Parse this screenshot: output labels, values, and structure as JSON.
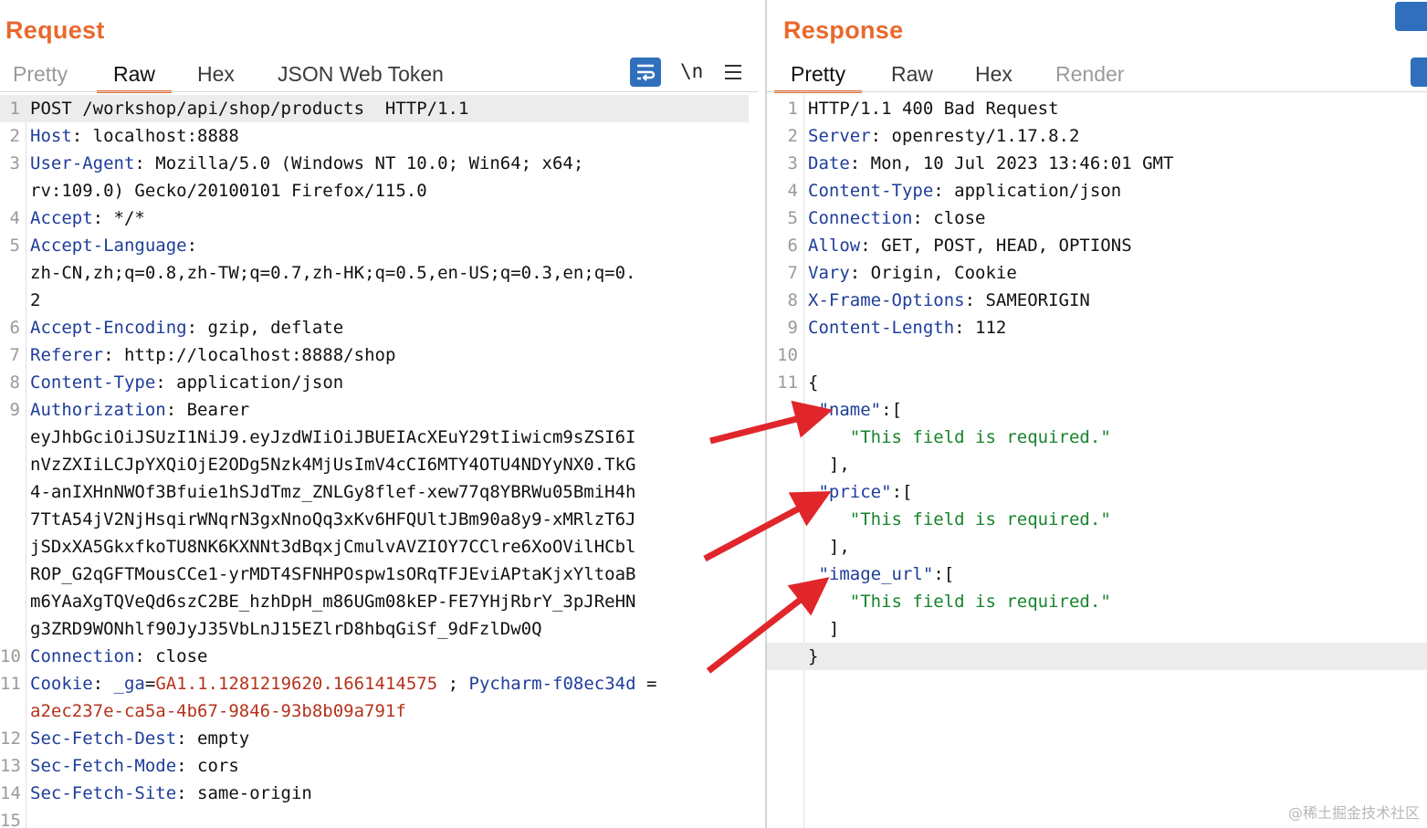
{
  "request": {
    "title": "Request",
    "tabs": [
      {
        "label": "Pretty",
        "active": false,
        "dim": true
      },
      {
        "label": "Raw",
        "active": true,
        "dim": false
      },
      {
        "label": "Hex",
        "active": false,
        "dim": false
      },
      {
        "label": "JSON Web Token",
        "active": false,
        "dim": false
      }
    ],
    "toolbar": {
      "wrap_icon": "wrap-text-icon",
      "newline_label": "\\n",
      "menu_icon": "hamburger-menu-icon"
    },
    "lines": [
      {
        "n": "1",
        "text": "POST /workshop/api/shop/products  HTTP/1.1"
      },
      {
        "n": "2",
        "key": "Host",
        "value": "localhost:8888"
      },
      {
        "n": "3",
        "key": "User-Agent",
        "value": "Mozilla/5.0 (Windows NT 10.0; Win64; x64;"
      },
      {
        "n": "",
        "text": "rv:109.0) Gecko/20100101 Firefox/115.0"
      },
      {
        "n": "4",
        "key": "Accept",
        "value": "*/*"
      },
      {
        "n": "5",
        "key": "Accept-Language",
        "value": ""
      },
      {
        "n": "",
        "text": "zh-CN,zh;q=0.8,zh-TW;q=0.7,zh-HK;q=0.5,en-US;q=0.3,en;q=0."
      },
      {
        "n": "",
        "text": "2"
      },
      {
        "n": "6",
        "key": "Accept-Encoding",
        "value": "gzip, deflate"
      },
      {
        "n": "7",
        "key": "Referer",
        "value": "http://localhost:8888/shop"
      },
      {
        "n": "8",
        "key": "Content-Type",
        "value": "application/json"
      },
      {
        "n": "9",
        "key": "Authorization",
        "value": "Bearer"
      },
      {
        "n": "",
        "text": "eyJhbGciOiJSUzI1NiJ9.eyJzdWIiOiJBUEIAcXEuY29tIiwicm9sZSI6I"
      },
      {
        "n": "",
        "text": "nVzZXIiLCJpYXQiOjE2ODg5Nzk4MjUsImV4cCI6MTY4OTU4NDYyNX0.TkG"
      },
      {
        "n": "",
        "text": "4-anIXHnNWOf3Bfuie1hSJdTmz_ZNLGy8flef-xew77q8YBRWu05BmiH4h"
      },
      {
        "n": "",
        "text": "7TtA54jV2NjHsqirWNqrN3gxNnoQq3xKv6HFQUltJBm90a8y9-xMRlzT6J"
      },
      {
        "n": "",
        "text": "jSDxXA5GkxfkoTU8NK6KXNNt3dBqxjCmulvAVZIOY7CClre6XoOVilHCbl"
      },
      {
        "n": "",
        "text": "ROP_G2qGFTMousCCe1-yrMDT4SFNHPOspw1sORqTFJEviAPtaKjxYltoaB"
      },
      {
        "n": "",
        "text": "m6YAaXgTQVeQd6szC2BE_hzhDpH_m86UGm08kEP-FE7YHjRbrY_3pJReHN"
      },
      {
        "n": "",
        "text": "g3ZRD9WONhlf90JyJ35VbLnJ15EZlrD8hbqGiSf_9dFzlDw0Q"
      },
      {
        "n": "10",
        "key": "Connection",
        "value": "close"
      },
      {
        "n": "11",
        "key": "Cookie",
        "cookie1_name": "_ga",
        "cookie1_value": "GA1.1.1281219620.1661414575",
        "cookie2_name": "Pycharm-f08ec34d",
        "cookie2_value": "a2ec237e-ca5a-4b67-9846-93b8b09a791f"
      },
      {
        "n": "12",
        "key": "Sec-Fetch-Dest",
        "value": "empty"
      },
      {
        "n": "13",
        "key": "Sec-Fetch-Mode",
        "value": "cors"
      },
      {
        "n": "14",
        "key": "Sec-Fetch-Site",
        "value": "same-origin"
      },
      {
        "n": "15",
        "text": ""
      }
    ]
  },
  "response": {
    "title": "Response",
    "tabs": [
      {
        "label": "Pretty",
        "active": true,
        "dim": false
      },
      {
        "label": "Raw",
        "active": false,
        "dim": false
      },
      {
        "label": "Hex",
        "active": false,
        "dim": false
      },
      {
        "label": "Render",
        "active": false,
        "dim": true
      }
    ],
    "lines": [
      {
        "n": "1",
        "text": "HTTP/1.1 400 Bad Request"
      },
      {
        "n": "2",
        "key": "Server",
        "value": "openresty/1.17.8.2"
      },
      {
        "n": "3",
        "key": "Date",
        "value": "Mon, 10 Jul 2023 13:46:01 GMT"
      },
      {
        "n": "4",
        "key": "Content-Type",
        "value": "application/json"
      },
      {
        "n": "5",
        "key": "Connection",
        "value": "close"
      },
      {
        "n": "6",
        "key": "Allow",
        "value": "GET, POST, HEAD, OPTIONS"
      },
      {
        "n": "7",
        "key": "Vary",
        "value": "Origin, Cookie"
      },
      {
        "n": "8",
        "key": "X-Frame-Options",
        "value": "SAMEORIGIN"
      },
      {
        "n": "9",
        "key": "Content-Length",
        "value": "112"
      },
      {
        "n": "10",
        "text": ""
      },
      {
        "n": "11",
        "text": "{"
      },
      {
        "n": "",
        "jkey": "name",
        "jtail": ":["
      },
      {
        "n": "",
        "jstr": "This field is required."
      },
      {
        "n": "",
        "text": "  ],"
      },
      {
        "n": "",
        "jkey": "price",
        "jtail": ":["
      },
      {
        "n": "",
        "jstr": "This field is required."
      },
      {
        "n": "",
        "text": "  ],"
      },
      {
        "n": "",
        "jkey": "image_url",
        "jtail": ":["
      },
      {
        "n": "",
        "jstr": "This field is required."
      },
      {
        "n": "",
        "text": "  ]"
      },
      {
        "n": "",
        "text": "}"
      }
    ]
  },
  "annotations": {
    "arrow_color": "#e0262b",
    "arrow_count": 3
  },
  "colors": {
    "accent": "#e8692c",
    "header_key": "#1f3d99",
    "json_string": "#17842c",
    "cookie_value": "#b5331c",
    "tool_blue": "#2f6fbc"
  },
  "watermark": "@稀土掘金技术社区"
}
